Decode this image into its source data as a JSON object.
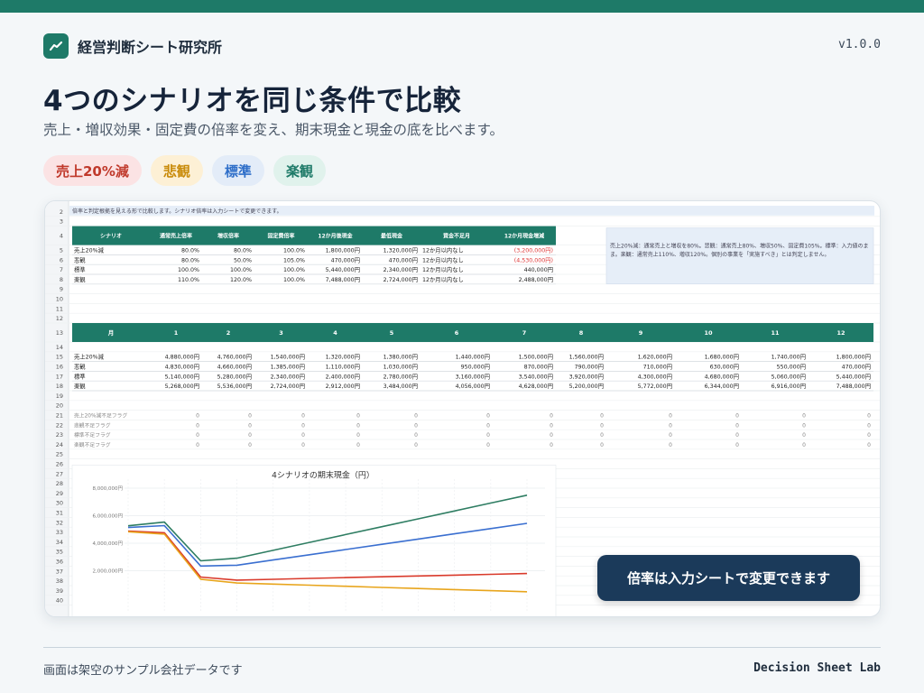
{
  "brand": {
    "name": "経営判断シート研究所",
    "version": "v1.0.0"
  },
  "hero": {
    "title": "4つのシナリオを同じ条件で比較",
    "subtitle": "売上・増収効果・固定費の倍率を変え、期末現金と現金の底を比べます。"
  },
  "chips": [
    {
      "label": "売上20%減",
      "bg": "#fbe3e4",
      "fg": "#c0392b"
    },
    {
      "label": "悲観",
      "bg": "#fdf0d5",
      "fg": "#c98b0a"
    },
    {
      "label": "標準",
      "bg": "#e3ecf8",
      "fg": "#2f6fc9"
    },
    {
      "label": "楽観",
      "bg": "#e0f2ec",
      "fg": "#1e7a68"
    }
  ],
  "sheet": {
    "note_row": "倍率と判定根拠を見える形で比較します。シナリオ倍率は入力シートで変更できます。",
    "summary_headers": [
      "シナリオ",
      "通常売上倍率",
      "増収倍率",
      "固定費倍率",
      "12か月後現金",
      "最低現金",
      "資金不足月",
      "12か月現金増減"
    ],
    "summary_rows": [
      {
        "row": "5",
        "cells": [
          "売上20%減",
          "80.0%",
          "80.0%",
          "100.0%",
          "1,800,000円",
          "1,320,000円",
          "12か月以内なし",
          "(3,200,000円)"
        ],
        "neg": true
      },
      {
        "row": "6",
        "cells": [
          "悲観",
          "80.0%",
          "50.0%",
          "105.0%",
          "470,000円",
          "470,000円",
          "12か月以内なし",
          "(4,530,000円)"
        ],
        "neg": true
      },
      {
        "row": "7",
        "cells": [
          "標準",
          "100.0%",
          "100.0%",
          "100.0%",
          "5,440,000円",
          "2,340,000円",
          "12か月以内なし",
          "440,000円"
        ],
        "neg": false
      },
      {
        "row": "8",
        "cells": [
          "楽観",
          "110.0%",
          "120.0%",
          "100.0%",
          "7,488,000円",
          "2,724,000円",
          "12か月以内なし",
          "2,488,000円"
        ],
        "neg": false
      }
    ],
    "note_box": "売上20%減：通常売上と増収を80%。悲観：通常売上80%、増収50%、固定費105%。標準：入力値のまま。楽観：通常売上110%、増収120%。個別の事業を「実施すべき」とは判定しません。",
    "monthly_header_label": "月",
    "months": [
      "1",
      "2",
      "3",
      "4",
      "5",
      "6",
      "7",
      "8",
      "9",
      "10",
      "11",
      "12"
    ],
    "monthly_rows": [
      {
        "row": "15",
        "label": "売上20%減",
        "values": [
          "4,880,000円",
          "4,760,000円",
          "1,540,000円",
          "1,320,000円",
          "1,380,000円",
          "1,440,000円",
          "1,500,000円",
          "1,560,000円",
          "1,620,000円",
          "1,680,000円",
          "1,740,000円",
          "1,800,000円"
        ]
      },
      {
        "row": "16",
        "label": "悲観",
        "values": [
          "4,830,000円",
          "4,660,000円",
          "1,385,000円",
          "1,110,000円",
          "1,030,000円",
          "950,000円",
          "870,000円",
          "790,000円",
          "710,000円",
          "630,000円",
          "550,000円",
          "470,000円"
        ]
      },
      {
        "row": "17",
        "label": "標準",
        "values": [
          "5,140,000円",
          "5,280,000円",
          "2,340,000円",
          "2,400,000円",
          "2,780,000円",
          "3,160,000円",
          "3,540,000円",
          "3,920,000円",
          "4,300,000円",
          "4,680,000円",
          "5,060,000円",
          "5,440,000円"
        ]
      },
      {
        "row": "18",
        "label": "楽観",
        "values": [
          "5,268,000円",
          "5,536,000円",
          "2,724,000円",
          "2,912,000円",
          "3,484,000円",
          "4,056,000円",
          "4,628,000円",
          "5,200,000円",
          "5,772,000円",
          "6,344,000円",
          "6,916,000円",
          "7,488,000円"
        ]
      }
    ],
    "flag_rows": [
      {
        "row": "21",
        "label": "売上20%減不足フラグ"
      },
      {
        "row": "22",
        "label": "悲観不足フラグ"
      },
      {
        "row": "23",
        "label": "標準不足フラグ"
      },
      {
        "row": "24",
        "label": "楽観不足フラグ"
      }
    ],
    "flag_value": "0"
  },
  "chart_data": {
    "type": "line",
    "title": "4シナリオの期末現金（円）",
    "x": [
      1,
      2,
      3,
      4,
      5,
      6,
      7,
      8,
      9,
      10,
      11,
      12
    ],
    "ylim": [
      0,
      8000000
    ],
    "yticks": [
      "8,000,000円",
      "6,000,000円",
      "4,000,000円",
      "2,000,000円"
    ],
    "ytick_values": [
      8000000,
      6000000,
      4000000,
      2000000
    ],
    "grid": true,
    "series": [
      {
        "name": "売上20%減",
        "color": "#d93a2b",
        "values": [
          4880000,
          4760000,
          1540000,
          1320000,
          1380000,
          1440000,
          1500000,
          1560000,
          1620000,
          1680000,
          1740000,
          1800000
        ]
      },
      {
        "name": "悲観",
        "color": "#e8a51c",
        "values": [
          4830000,
          4660000,
          1385000,
          1110000,
          1030000,
          950000,
          870000,
          790000,
          710000,
          630000,
          550000,
          470000
        ]
      },
      {
        "name": "標準",
        "color": "#3a6fd0",
        "values": [
          5140000,
          5280000,
          2340000,
          2400000,
          2780000,
          3160000,
          3540000,
          3920000,
          4300000,
          4680000,
          5060000,
          5440000
        ]
      },
      {
        "name": "楽観",
        "color": "#2e7d62",
        "values": [
          5268000,
          5536000,
          2724000,
          2912000,
          3484000,
          4056000,
          4628000,
          5200000,
          5772000,
          6344000,
          6916000,
          7488000
        ]
      }
    ]
  },
  "callout": "倍率は入力シートで変更できます",
  "footer": {
    "note": "画面は架空のサンプル会社データです",
    "brand": "Decision Sheet Lab"
  }
}
